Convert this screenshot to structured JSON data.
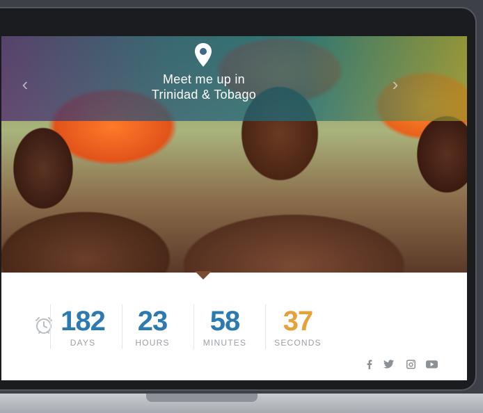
{
  "hero": {
    "line1": "Meet me up in",
    "line2": "Trinidad & Tobago",
    "prev_arrow": "‹",
    "next_arrow": "›"
  },
  "countdown": {
    "days": {
      "value": "182",
      "label": "DAYS"
    },
    "hours": {
      "value": "23",
      "label": "HOURS"
    },
    "minutes": {
      "value": "58",
      "label": "MINUTES"
    },
    "seconds": {
      "value": "37",
      "label": "SECONDS"
    }
  },
  "colors": {
    "blue": "#2b7bb2",
    "orange": "#e8a13a",
    "gray_icon": "#9aa0a6"
  },
  "icons": [
    "location-pin-icon",
    "alarm-clock-icon",
    "facebook-icon",
    "twitter-icon",
    "instagram-icon",
    "youtube-icon"
  ]
}
